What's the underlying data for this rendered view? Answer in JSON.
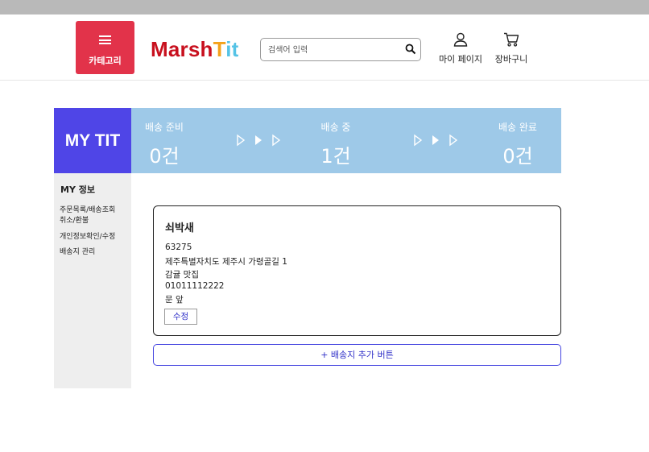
{
  "header": {
    "category_label": "카테고리",
    "logo": {
      "part1": "Marsh",
      "part2": "T",
      "part3": "it"
    },
    "search_placeholder": "검색어 입력",
    "mypage_label": "마이 페이지",
    "cart_label": "장바구니"
  },
  "status": {
    "title": "MY TIT",
    "stages": [
      {
        "label": "배송 준비",
        "count": "0건"
      },
      {
        "label": "배송 중",
        "count": "1건"
      },
      {
        "label": "배송 완료",
        "count": "0건"
      }
    ]
  },
  "sidebar": {
    "title": "MY 정보",
    "items": [
      {
        "label": "주문목록/배송조회"
      },
      {
        "label": "취소/환불"
      },
      {
        "label": "개인정보확인/수정"
      },
      {
        "label": "배송지 관리"
      }
    ]
  },
  "address_card": {
    "name": "쇠박새",
    "zipcode": "63275",
    "address": "제주특별자치도 제주시 가령골길 1",
    "detail": "감귤 맛집",
    "phone": "01011112222",
    "memo": "문 앞",
    "edit_label": "수정"
  },
  "add_address_label": "+ 배송지 추가 버튼",
  "colors": {
    "category_red": "#e2334a",
    "mytit_purple": "#4f45e7",
    "status_blue": "#9ec9e8",
    "link_blue": "#3030c8"
  }
}
